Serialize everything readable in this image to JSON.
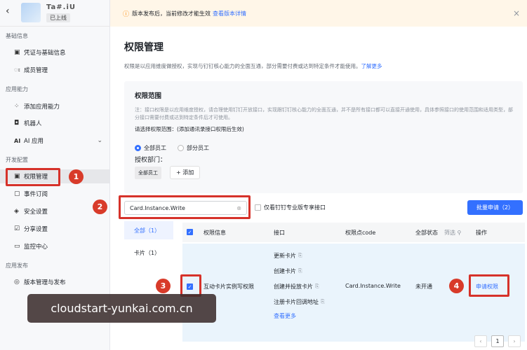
{
  "app": {
    "name": "Ta#.iU",
    "status": "已上线"
  },
  "sidebar": {
    "sections": [
      {
        "label": "基础信息"
      },
      {
        "label": "应用能力"
      },
      {
        "label": "开发配置"
      },
      {
        "label": "应用发布"
      }
    ],
    "items": [
      {
        "label": "凭证与基础信息",
        "icon": "credential-icon"
      },
      {
        "label": "成员管理",
        "icon": "user-icon"
      },
      {
        "label": "添加应用能力",
        "icon": "grid-icon"
      },
      {
        "label": "机器人",
        "icon": "robot-icon"
      },
      {
        "label": "AI 应用",
        "icon": "ai-icon"
      },
      {
        "label": "权限管理",
        "icon": "lock-icon"
      },
      {
        "label": "事件订阅",
        "icon": "event-icon"
      },
      {
        "label": "安全设置",
        "icon": "shield-icon"
      },
      {
        "label": "分享设置",
        "icon": "share-icon"
      },
      {
        "label": "监控中心",
        "icon": "monitor-icon"
      },
      {
        "label": "版本管理与发布",
        "icon": "version-icon"
      }
    ]
  },
  "notice": {
    "text": "版本发布后，当前修改才能生效",
    "link": "查看版本详情"
  },
  "page": {
    "title": "权限管理",
    "desc": "权限是以应用维度做授权，实现与钉钉核心能力的全面互通，部分需要付费或达到特定条件才能使用。",
    "desc_link": "了解更多"
  },
  "scope": {
    "title": "权限范围",
    "note": "注：接口权限是以应用维度授权，请合理使用钉钉开放接口，实现跟钉钉核心能力的全面互通，并不是所有接口都可以直接开通使用，具体参照接口的使用范围和适用类型，部分接口需要付费或达到特定条件后才可使用。",
    "question": "请选择权限范围：(添加通讯录接口权限后生效)",
    "radio_all": "全部员工",
    "radio_part": "部分员工",
    "dept_label": "授权部门：",
    "dept_chip": "全部员工",
    "add_label": "+ 添加"
  },
  "filter": {
    "search_value": "Card.Instance.Write",
    "only_label": "仅看钉钉专业版专享接口",
    "batch_label": "批量申请（2）"
  },
  "categories": [
    {
      "label": "全部（1）"
    },
    {
      "label": "卡片（1）"
    }
  ],
  "table": {
    "headers": [
      "权限信息",
      "接口",
      "权限点code",
      "全部状态",
      "筛选",
      "操作"
    ],
    "row": {
      "name": "互动卡片实例写权限",
      "interfaces": [
        "更新卡片",
        "创建卡片",
        "创建并投放卡片",
        "注册卡片回调地址"
      ],
      "more": "查看更多",
      "code": "Card.Instance.Write",
      "status": "未开通",
      "action": "申请权限"
    }
  },
  "annotations": [
    "1",
    "2",
    "3",
    "4"
  ],
  "watermark": "cloudstart-yunkai.com.cn",
  "pager": {
    "current": "1",
    "prev": "‹",
    "next": "›"
  }
}
